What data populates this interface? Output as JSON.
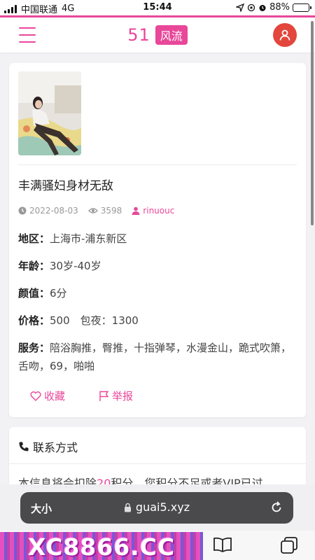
{
  "status_bar": {
    "carrier": "中国联通",
    "network": "4G",
    "time": "15:44",
    "battery": "88%",
    "battery_level": 0.88
  },
  "header": {
    "logo_number": "51",
    "logo_tag": "风流"
  },
  "post": {
    "title": "丰满骚妇身材无敌",
    "date": "2022-08-03",
    "views": "3598",
    "author": "rinuouc",
    "fields": [
      {
        "label": "地区：",
        "value": "上海市-浦东新区"
      },
      {
        "label": "年龄：",
        "value": "30岁-40岁"
      },
      {
        "label": "颜值：",
        "value": "6分"
      },
      {
        "label": "价格：",
        "value": "500　包夜：1300"
      },
      {
        "label": "服务：",
        "value": "陪浴胸推，臀推，十指弹琴，水漫金山，跪式吹箫，舌吻，69，啪啪"
      }
    ],
    "actions": {
      "favorite": "收藏",
      "report": "举报"
    }
  },
  "contact": {
    "title": "联系方式",
    "note_before": "本信息将会扣除",
    "note_points": "20",
    "note_after": "积分，您积分不足或者VIP已过"
  },
  "browser": {
    "aa_label": "大小",
    "url": "guai5.xyz"
  },
  "bottom": {
    "ad_text": "XC8866.CC"
  }
}
